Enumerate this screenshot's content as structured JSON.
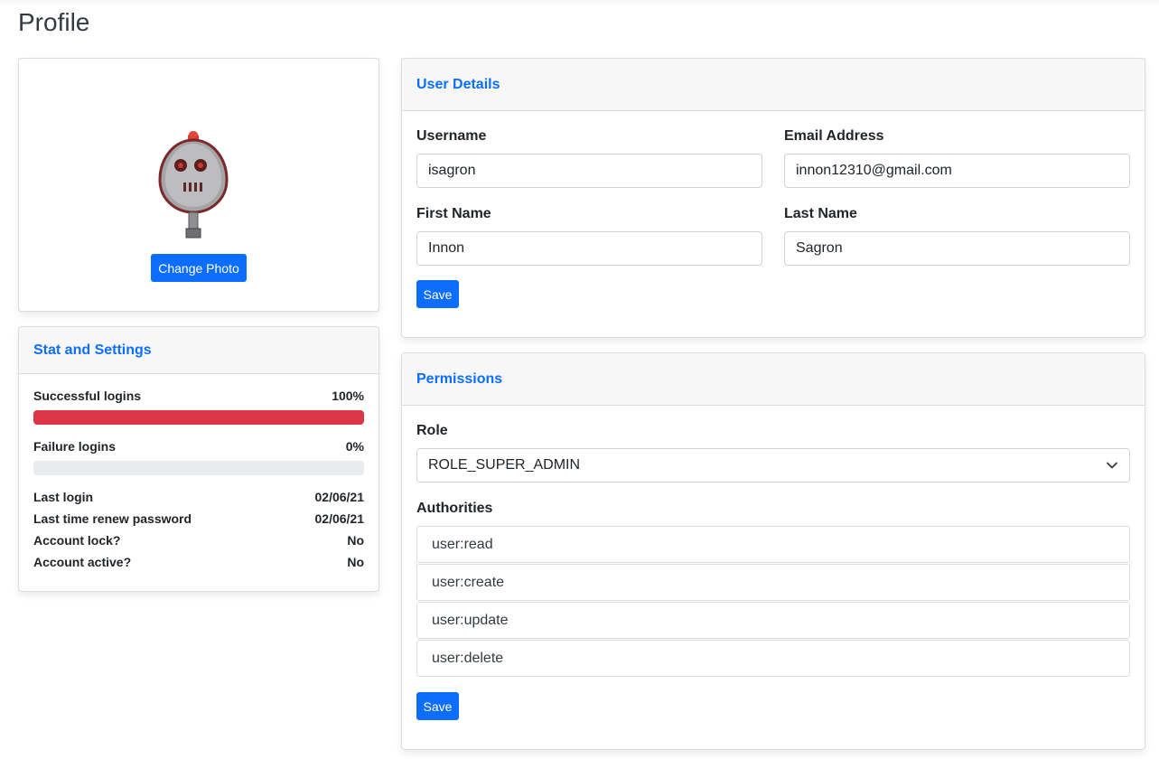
{
  "page": {
    "title": "Profile"
  },
  "photo_card": {
    "avatar_icon": "robot-avatar",
    "change_photo_label": "Change Photo"
  },
  "stats": {
    "header": "Stat and Settings",
    "successful_logins": {
      "label": "Successful logins",
      "value": "100%",
      "fraction": 1.0
    },
    "failure_logins": {
      "label": "Failure logins",
      "value": "0%",
      "fraction": 0.0
    },
    "rows": [
      {
        "label": "Last login",
        "value": "02/06/21"
      },
      {
        "label": "Last time renew password",
        "value": "02/06/21"
      },
      {
        "label": "Account lock?",
        "value": "No"
      },
      {
        "label": "Account active?",
        "value": "No"
      }
    ]
  },
  "user_details": {
    "header": "User Details",
    "username": {
      "label": "Username",
      "value": "isagron"
    },
    "email": {
      "label": "Email Address",
      "value": "innon12310@gmail.com"
    },
    "first_name": {
      "label": "First Name",
      "value": "Innon"
    },
    "last_name": {
      "label": "Last Name",
      "value": "Sagron"
    },
    "save_label": "Save"
  },
  "permissions": {
    "header": "Permissions",
    "role_label": "Role",
    "role_value": "ROLE_SUPER_ADMIN",
    "authorities_label": "Authorities",
    "authorities": [
      "user:read",
      "user:create",
      "user:update",
      "user:delete"
    ],
    "save_label": "Save"
  },
  "colors": {
    "primary": "#0d6efd",
    "danger": "#dc3545",
    "progress_track": "#e9ecef"
  }
}
